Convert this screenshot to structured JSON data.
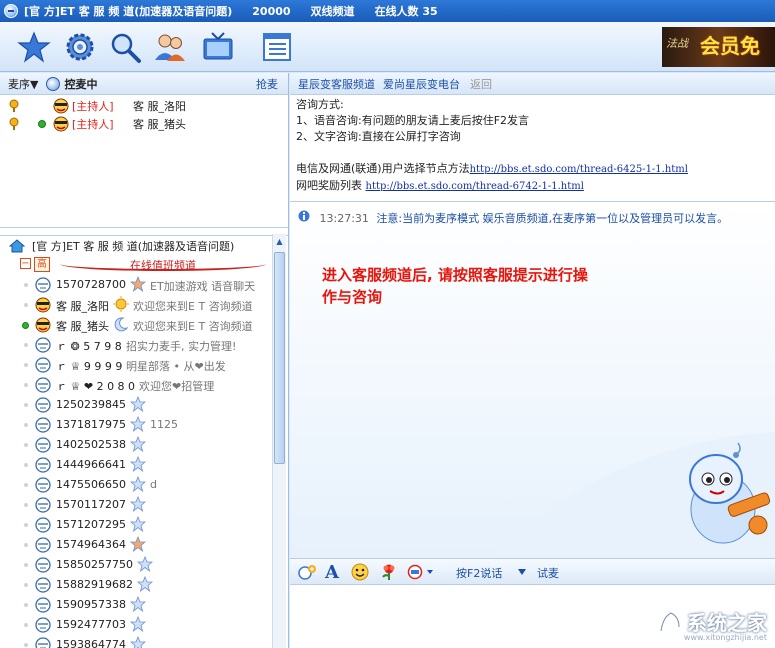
{
  "window": {
    "title": "[官 方]ET 客 服 频 道(加速器及语音问题)",
    "channel_id": "20000",
    "mode": "双线频道",
    "online_label": "在线人数 35"
  },
  "toolbar": {
    "icons": [
      "star-icon",
      "settings-icon",
      "search-icon",
      "friends-icon",
      "tv-icon",
      "list-icon"
    ],
    "banner_label": "会员免",
    "banner_logo": "法战"
  },
  "left": {
    "header": {
      "queue_label": "麦序▼",
      "control_label": "控麦中",
      "grab_label": "抢麦"
    },
    "hosts": [
      {
        "role": "[主持人]",
        "name": "客 服_洛阳",
        "online": false
      },
      {
        "role": "[主持人]",
        "name": "客 服_猪头",
        "online": true
      }
    ],
    "tree_title": "[官 方]ET 客 服 频 道(加速器及语音问题)",
    "group_icon": "高",
    "group_title": "在线值班频道",
    "users": [
      {
        "name": "1570728700",
        "badge": "star-orange",
        "sig": "ET加速游戏 语音聊天",
        "online": false
      },
      {
        "name": "客 服_洛阳",
        "badge": "sun",
        "sig": "欢迎您来到E T 咨询频道",
        "online": false,
        "host": true
      },
      {
        "name": "客 服_猪头",
        "badge": "moon",
        "sig": "欢迎您来到E T 咨询频道",
        "online": true,
        "host": true
      },
      {
        "name": "ｒ ❂ 5 7 9 8",
        "badge": "",
        "sig": "招实力麦手, 实力管理!",
        "online": false
      },
      {
        "name": "ｒ ♕ 9 9 9 9",
        "badge": "",
        "sig": "明星部落 • 从❤出发",
        "online": false
      },
      {
        "name": "ｒ ♕ ❤ 2 0 8 0",
        "badge": "",
        "sig": "欢迎您❤招管理",
        "online": false
      },
      {
        "name": "1250239845",
        "badge": "star-blue",
        "sig": "",
        "online": false
      },
      {
        "name": "1371817975",
        "badge": "star-blue",
        "sig": "1125",
        "online": false
      },
      {
        "name": "1402502538",
        "badge": "star-blue",
        "sig": "",
        "online": false
      },
      {
        "name": "1444966641",
        "badge": "star-blue",
        "sig": "",
        "online": false
      },
      {
        "name": "1475506650",
        "badge": "star-blue",
        "sig": "d",
        "online": false
      },
      {
        "name": "1570117207",
        "badge": "star-blue",
        "sig": "",
        "online": false
      },
      {
        "name": "1571207295",
        "badge": "star-blue",
        "sig": "",
        "online": false
      },
      {
        "name": "1574964364",
        "badge": "star-orange",
        "sig": "",
        "online": false
      },
      {
        "name": "15850257750",
        "badge": "star-blue",
        "sig": "",
        "online": false
      },
      {
        "name": "15882919682",
        "badge": "star-blue",
        "sig": "",
        "online": false
      },
      {
        "name": "1590957338",
        "badge": "star-blue",
        "sig": "",
        "online": false
      },
      {
        "name": "1592477703",
        "badge": "star-blue",
        "sig": "",
        "online": false
      },
      {
        "name": "1593864774",
        "badge": "star-blue",
        "sig": "",
        "online": false
      }
    ]
  },
  "right": {
    "tabs": [
      "星辰变客服频道",
      "爱尚星辰变电台",
      "返回"
    ],
    "notice": {
      "line1": "咨询方式:",
      "line2": "1、语音咨询:有问题的朋友请上麦后按住F2发言",
      "line3": "2、文字咨询:直接在公屏打字咨询",
      "line4_prefix": "电信及网通(联通)用户选择节点方法",
      "line4_link": "http://bbs.et.sdo.com/thread-6425-1-1.html",
      "line5_prefix": "网吧奖励列表 ",
      "line5_link": "http://bbs.et.sdo.com/thread-6742-1-1.html"
    },
    "message": {
      "time": "13:27:31",
      "text": "注意:当前为麦序模式 娱乐音质频道,在麦序第一位以及管理员可以发言。"
    },
    "tip": "进入客服频道后, 请按照客服提示进行操作与咨询",
    "input_toolbar": {
      "f2_label": "按F2说话",
      "test_label": "试麦"
    },
    "watermark": {
      "name": "系统之家",
      "site": "www.xitongzhijia.net"
    }
  }
}
